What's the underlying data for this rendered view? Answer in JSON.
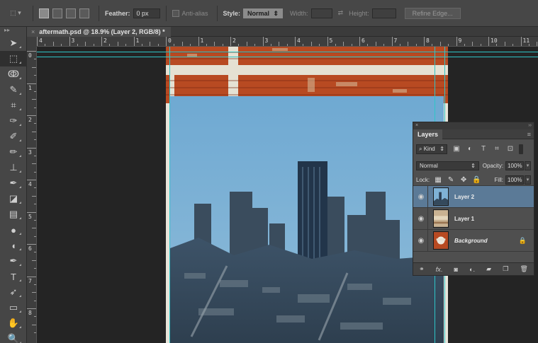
{
  "options_bar": {
    "feather_label": "Feather:",
    "feather_value": "0 px",
    "anti_alias_label": "Anti-alias",
    "style_label": "Style:",
    "style_value": "Normal",
    "width_label": "Width:",
    "height_label": "Height:",
    "refine_edge_label": "Refine Edge..."
  },
  "document": {
    "tab_title": "aftermath.psd @ 18.9% (Layer 2, RGB/8) *",
    "close_glyph": "×"
  },
  "ruler_top": [
    "4",
    "3",
    "2",
    "1",
    "0",
    "1",
    "2",
    "3",
    "4",
    "5",
    "6",
    "7",
    "8",
    "9",
    "10",
    "11"
  ],
  "ruler_left": [
    "0",
    "1",
    "2",
    "3",
    "4",
    "5",
    "6",
    "7",
    "8"
  ],
  "toolbar": {
    "tools": [
      {
        "name": "move-tool-icon",
        "glyph": "➤"
      },
      {
        "name": "rectangular-marquee-tool-icon",
        "glyph": "⬚"
      },
      {
        "name": "lasso-tool-icon",
        "glyph": "ↂ"
      },
      {
        "name": "quick-selection-tool-icon",
        "glyph": "✎"
      },
      {
        "name": "crop-tool-icon",
        "glyph": "⌗"
      },
      {
        "name": "eyedropper-tool-icon",
        "glyph": "✑"
      },
      {
        "name": "spot-healing-brush-icon",
        "glyph": "✐"
      },
      {
        "name": "brush-tool-icon",
        "glyph": "✏"
      },
      {
        "name": "clone-stamp-tool-icon",
        "glyph": "⊥"
      },
      {
        "name": "history-brush-tool-icon",
        "glyph": "✒"
      },
      {
        "name": "eraser-tool-icon",
        "glyph": "◪"
      },
      {
        "name": "gradient-tool-icon",
        "glyph": "▤"
      },
      {
        "name": "blur-tool-icon",
        "glyph": "●"
      },
      {
        "name": "dodge-tool-icon",
        "glyph": "◖"
      },
      {
        "name": "pen-tool-icon",
        "glyph": "✒"
      },
      {
        "name": "type-tool-icon",
        "glyph": "T"
      },
      {
        "name": "path-selection-tool-icon",
        "glyph": "➶"
      },
      {
        "name": "rectangle-tool-icon",
        "glyph": "▭"
      },
      {
        "name": "hand-tool-icon",
        "glyph": "✋"
      },
      {
        "name": "zoom-tool-icon",
        "glyph": "🔍"
      }
    ]
  },
  "layers_panel": {
    "title_glyph_left": "×",
    "title_glyph_right": "››",
    "tab_label": "Layers",
    "menu_glyph": "≡",
    "kind_label": "Kind",
    "blend_mode": "Normal",
    "opacity_label": "Opacity:",
    "opacity_value": "100%",
    "lock_label": "Lock:",
    "fill_label": "Fill:",
    "fill_value": "100%",
    "layers": [
      {
        "name": "Layer 2",
        "selected": true
      },
      {
        "name": "Layer 1",
        "selected": false
      },
      {
        "name": "Background",
        "selected": false,
        "locked": true
      }
    ],
    "footer_icons": [
      "link-layers-icon",
      "fx-icon",
      "add-mask-icon",
      "adjustment-layer-icon",
      "new-group-icon",
      "new-layer-icon",
      "delete-layer-icon"
    ]
  },
  "colors": {
    "guide": "#2ec6c8",
    "selected_layer": "#5b7a97",
    "sky_top": "#76aed3",
    "brick": "#b84a22"
  }
}
